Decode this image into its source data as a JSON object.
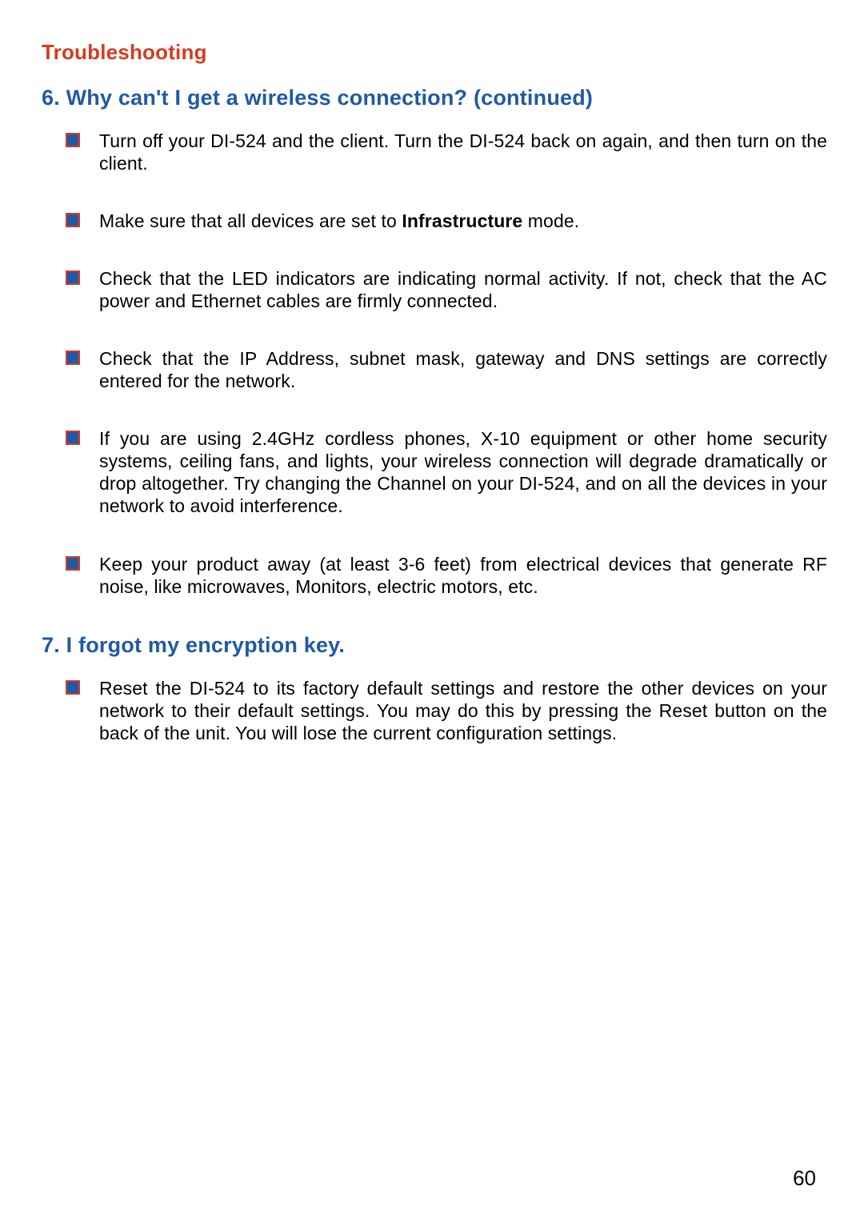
{
  "section_title": "Troubleshooting",
  "page_number": "60",
  "q6": {
    "heading": "6.  Why can't I get a wireless connection? (continued)",
    "items": [
      {
        "text": "Turn off your DI-524 and the client. Turn the DI-524 back on again, and then turn on the client."
      },
      {
        "html": "Make sure that all devices are set to <b>Infrastructure</b> mode."
      },
      {
        "text": "Check that the LED indicators are indicating normal activity. If not, check that the AC power and Ethernet cables are firmly connected."
      },
      {
        "text": "Check that the IP Address, subnet mask, gateway and DNS settings are correctly entered for the network."
      },
      {
        "text": "If you are using 2.4GHz cordless phones, X-10 equipment or other home security systems, ceiling fans, and lights, your wireless connection will degrade dramatically or drop altogether. Try changing the Channel on your DI-524, and on all the devices in your network to avoid interference."
      },
      {
        "text": "Keep your product away (at least 3-6 feet) from electrical devices that generate RF noise, like microwaves, Monitors, electric motors, etc."
      }
    ]
  },
  "q7": {
    "heading": "7.  I forgot my encryption key.",
    "items": [
      {
        "text": "Reset the DI-524 to its factory default settings and restore the other devices on your network to their default settings. You may do this by pressing the Reset button on the back of the unit. You will lose the current configuration settings."
      }
    ]
  }
}
